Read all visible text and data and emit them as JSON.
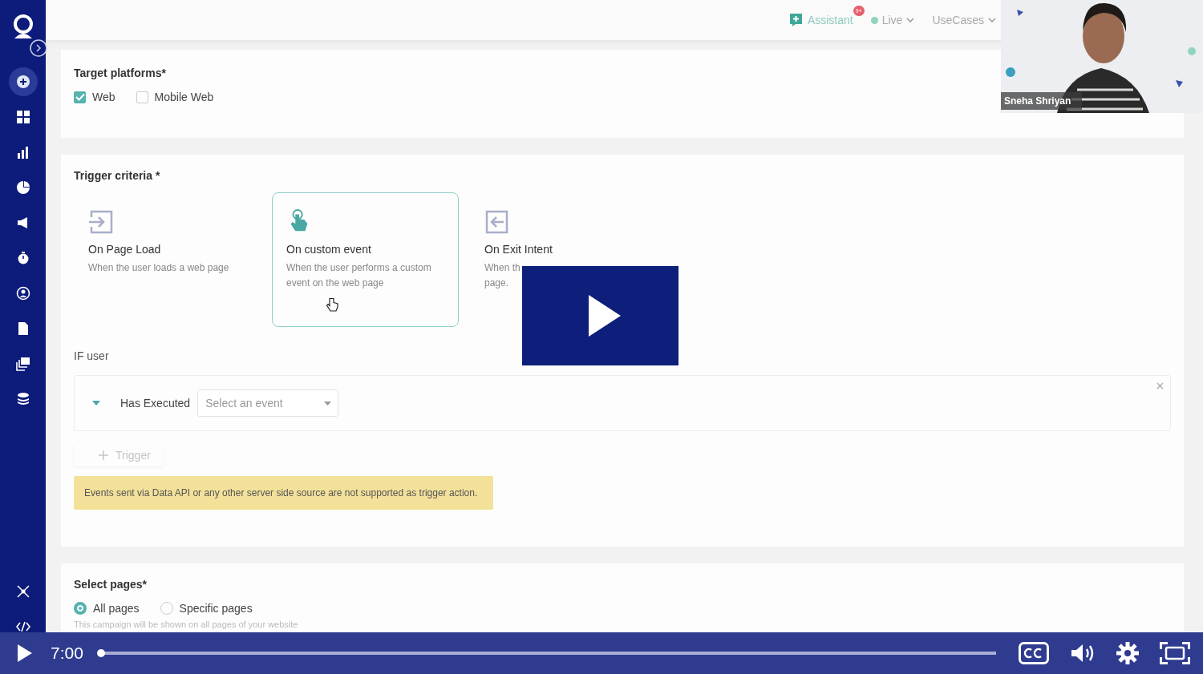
{
  "header": {
    "assistant": {
      "label": "Assistant",
      "badge": "9+"
    },
    "status": {
      "label": "Live",
      "color": "#8fd3c0"
    },
    "menu": {
      "label": "UseCases"
    }
  },
  "sidebar": {
    "items": [
      {
        "selected": true
      },
      {
        "selected": false
      },
      {
        "selected": false
      },
      {
        "selected": false
      },
      {
        "selected": false
      },
      {
        "selected": false
      },
      {
        "selected": false
      },
      {
        "selected": false
      },
      {
        "selected": false
      },
      {
        "selected": false
      }
    ]
  },
  "target_platforms": {
    "title": "Target platforms*",
    "options": [
      {
        "label": "Web",
        "checked": true
      },
      {
        "label": "Mobile Web",
        "checked": false
      }
    ]
  },
  "trigger_criteria": {
    "title": "Trigger criteria *",
    "options": [
      {
        "title": "On Page Load",
        "description": "When the user loads a web page",
        "selected": false
      },
      {
        "title": "On custom event",
        "description": "When the user performs a custom event on the web page",
        "selected": true
      },
      {
        "title": "On Exit Intent",
        "description": "When th\npage.",
        "selected": false
      }
    ]
  },
  "if_user": {
    "label": "IF user",
    "condition": {
      "expanded": true,
      "action": "Has Executed",
      "select_placeholder": "Select an event"
    },
    "add_trigger": "Trigger",
    "notice": "Events sent via Data API or any other server side source are not supported as trigger action."
  },
  "select_pages": {
    "title": "Select pages*",
    "options": [
      {
        "label": "All pages",
        "selected": true
      },
      {
        "label": "Specific pages",
        "selected": false
      }
    ],
    "hint": "This campaign will be shown on all pages of your website"
  },
  "webcam": {
    "name": "Sneha Shriyan"
  },
  "player": {
    "time": "7:00",
    "level": 0.004
  }
}
